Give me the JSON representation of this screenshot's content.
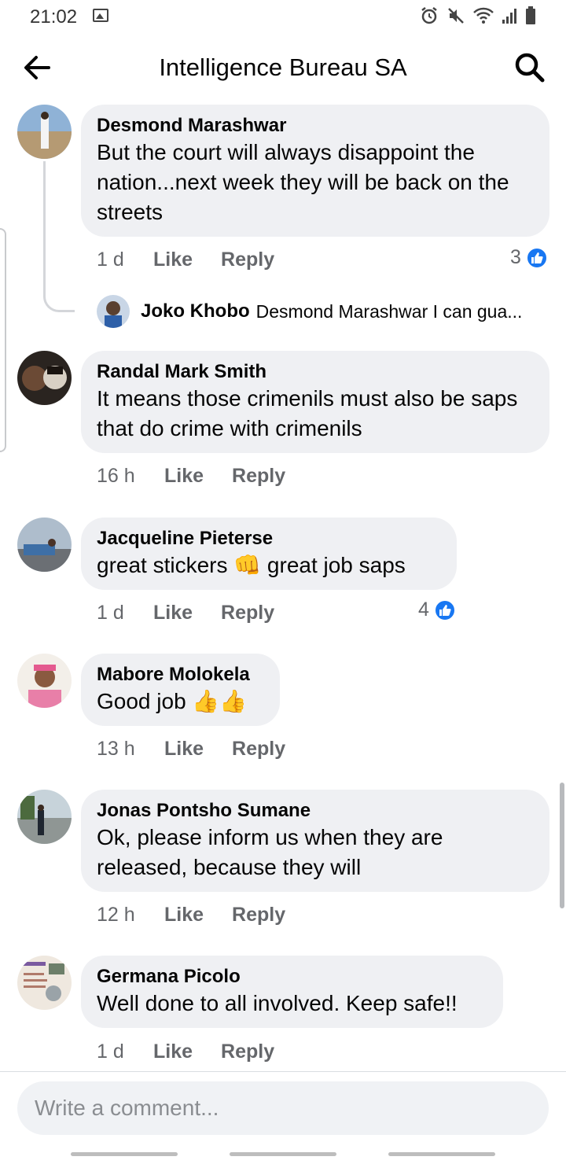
{
  "status_bar": {
    "time": "21:02"
  },
  "header": {
    "title": "Intelligence Bureau SA"
  },
  "comments": [
    {
      "name": "Desmond Marashwar",
      "text": "But the court will always disappoint the nation...next week they will be back on the streets",
      "time": "1 d",
      "like": "Like",
      "reply": "Reply",
      "reactions": "3"
    },
    {
      "name": "Randal Mark Smith",
      "text": "It means those crimenils must also be saps that do crime with crimenils",
      "time": "16 h",
      "like": "Like",
      "reply": "Reply"
    },
    {
      "name": "Jacqueline Pieterse",
      "text": "great stickers 👊 great job saps",
      "time": "1 d",
      "like": "Like",
      "reply": "Reply",
      "reactions": "4"
    },
    {
      "name": "Mabore Molokela",
      "text": "Good job 👍👍",
      "time": "13 h",
      "like": "Like",
      "reply": "Reply"
    },
    {
      "name": "Jonas Pontsho Sumane",
      "text": "Ok, please inform us when they are released, because they will",
      "time": "12 h",
      "like": "Like",
      "reply": "Reply"
    },
    {
      "name": "Germana Picolo",
      "text": "Well done to all involved. Keep safe!!",
      "time": "1 d",
      "like": "Like",
      "reply": "Reply"
    }
  ],
  "reply_preview": {
    "name": "Joko Khobo",
    "text": "Desmond Marashwar I can gua..."
  },
  "composer": {
    "placeholder": "Write a comment..."
  },
  "colors": {
    "accent": "#1877f2",
    "bubble": "#eff0f3",
    "muted": "#65676b"
  }
}
